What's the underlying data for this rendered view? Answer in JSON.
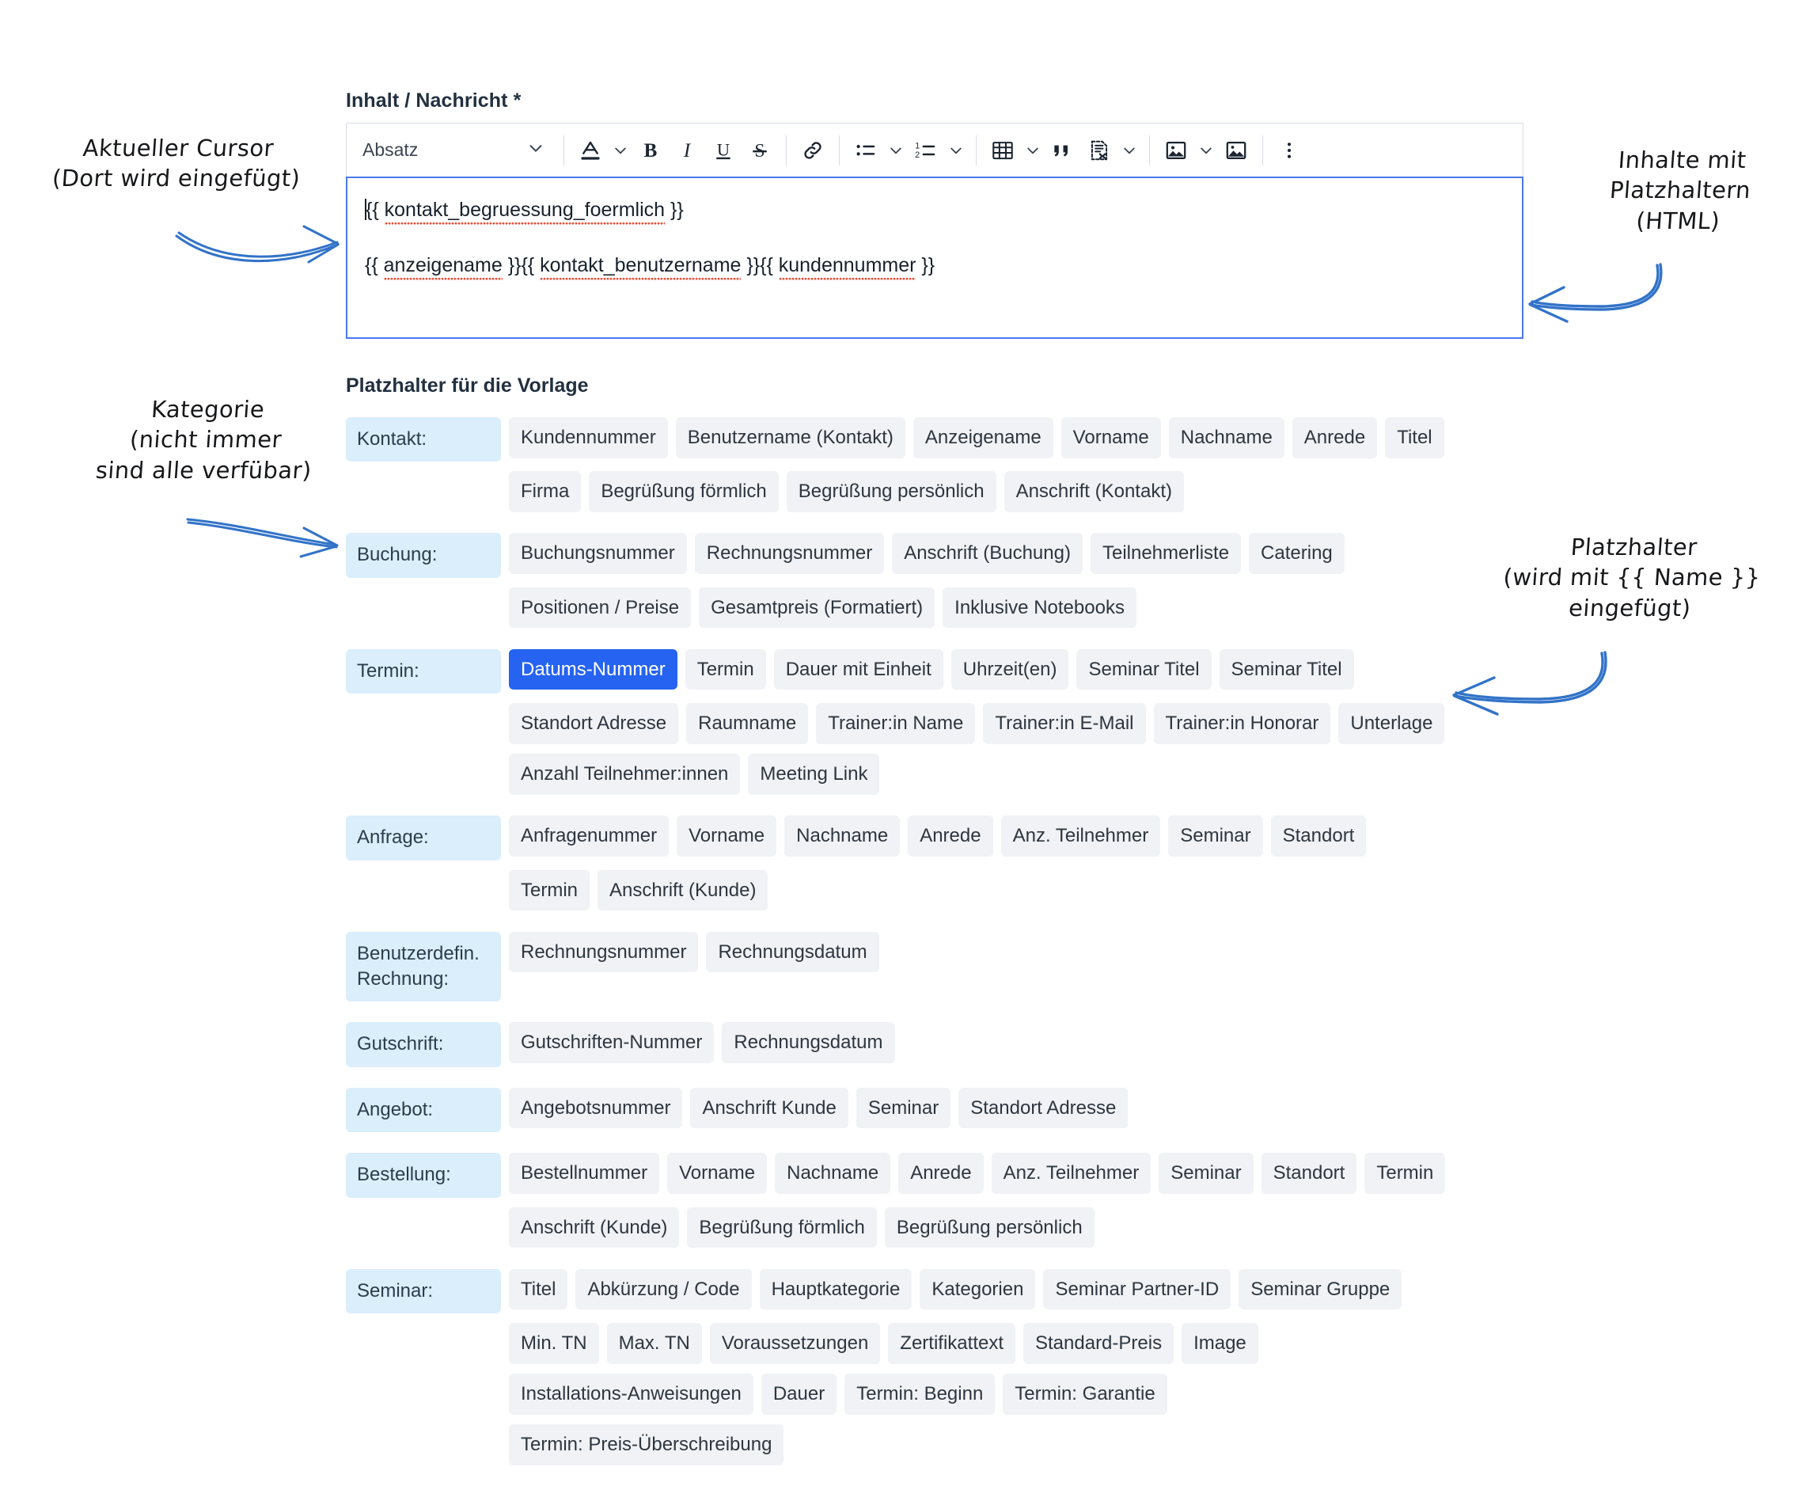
{
  "field": {
    "label": "Inhalt / Nachricht *"
  },
  "toolbar": {
    "block_style": "Absatz",
    "items": [
      {
        "name": "block-style-select",
        "label": "Absatz"
      },
      {
        "name": "text-color-button",
        "label": "A"
      },
      {
        "name": "bold-button",
        "label": "B"
      },
      {
        "name": "italic-button",
        "label": "I"
      },
      {
        "name": "underline-button",
        "label": "U"
      },
      {
        "name": "strikethrough-button",
        "label": "S"
      },
      {
        "name": "link-button",
        "label": "Link"
      },
      {
        "name": "bullet-list-button",
        "label": "Aufzählungsliste"
      },
      {
        "name": "numbered-list-button",
        "label": "Nummerierte Liste"
      },
      {
        "name": "table-button",
        "label": "Tabelle"
      },
      {
        "name": "blockquote-button",
        "label": "Zitat"
      },
      {
        "name": "code-block-button",
        "label": "Code-Block"
      },
      {
        "name": "image-button",
        "label": "Bild"
      },
      {
        "name": "media-button",
        "label": "Medien"
      },
      {
        "name": "more-options-button",
        "label": "Mehr"
      }
    ]
  },
  "editor": {
    "lines": [
      {
        "text": "{{ kontakt_begruessung_foermlich }}",
        "spellcheck_word": "kontakt_begruessung_foermlich",
        "has_caret": true
      },
      {
        "text": "{{ anzeigename }}{{ kontakt_benutzername }}{{ kundennummer }}",
        "has_caret": false
      }
    ],
    "line1_prefix": "{{ ",
    "line1_word": "kontakt_begruessung_foermlich",
    "line1_suffix": " }}",
    "line2_parts": [
      {
        "pre": "{{ ",
        "word": "anzeigename",
        "post": " }}"
      },
      {
        "pre": "{{ ",
        "word": "kontakt_benutzername",
        "post": " }}"
      },
      {
        "pre": "{{ ",
        "word": "kundennummer",
        "post": " }}"
      }
    ]
  },
  "placeholders": {
    "title": "Platzhalter für die Vorlage",
    "selected_chip": "Datums-Nummer",
    "categories": [
      {
        "label": "Kontakt:",
        "rows": [
          [
            "Kundennummer",
            "Benutzername (Kontakt)",
            "Anzeigename",
            "Vorname",
            "Nachname",
            "Anrede",
            "Titel"
          ],
          [
            "Firma",
            "Begrüßung förmlich",
            "Begrüßung persönlich",
            "Anschrift (Kontakt)"
          ]
        ]
      },
      {
        "label": "Buchung:",
        "rows": [
          [
            "Buchungsnummer",
            "Rechnungsnummer",
            "Anschrift (Buchung)",
            "Teilnehmerliste",
            "Catering"
          ],
          [
            "Positionen / Preise",
            "Gesamtpreis (Formatiert)",
            "Inklusive Notebooks"
          ]
        ]
      },
      {
        "label": "Termin:",
        "rows": [
          [
            "Datums-Nummer",
            "Termin",
            "Dauer mit Einheit",
            "Uhrzeit(en)",
            "Seminar Titel",
            "Seminar Titel"
          ],
          [
            "Standort Adresse",
            "Raumname",
            "Trainer:in Name",
            "Trainer:in E-Mail",
            "Trainer:in Honorar",
            "Unterlage"
          ],
          [
            "Anzahl Teilnehmer:innen",
            "Meeting Link"
          ]
        ]
      },
      {
        "label": "Anfrage:",
        "rows": [
          [
            "Anfragenummer",
            "Vorname",
            "Nachname",
            "Anrede",
            "Anz. Teilnehmer",
            "Seminar",
            "Standort"
          ],
          [
            "Termin",
            "Anschrift (Kunde)"
          ]
        ]
      },
      {
        "label": "Benutzerdefin. Rechnung:",
        "rows": [
          [
            "Rechnungsnummer",
            "Rechnungsdatum"
          ]
        ]
      },
      {
        "label": "Gutschrift:",
        "rows": [
          [
            "Gutschriften-Nummer",
            "Rechnungsdatum"
          ]
        ]
      },
      {
        "label": "Angebot:",
        "rows": [
          [
            "Angebotsnummer",
            "Anschrift Kunde",
            "Seminar",
            "Standort Adresse"
          ]
        ]
      },
      {
        "label": "Bestellung:",
        "rows": [
          [
            "Bestellnummer",
            "Vorname",
            "Nachname",
            "Anrede",
            "Anz. Teilnehmer",
            "Seminar",
            "Standort",
            "Termin"
          ],
          [
            "Anschrift (Kunde)",
            "Begrüßung förmlich",
            "Begrüßung persönlich"
          ]
        ]
      },
      {
        "label": "Seminar:",
        "rows": [
          [
            "Titel",
            "Abkürzung / Code",
            "Hauptkategorie",
            "Kategorien",
            "Seminar Partner-ID",
            "Seminar Gruppe"
          ],
          [
            "Min. TN",
            "Max. TN",
            "Voraussetzungen",
            "Zertifikattext",
            "Standard-Preis",
            "Image"
          ],
          [
            "Installations-Anweisungen",
            "Dauer",
            "Termin: Beginn",
            "Termin: Garantie"
          ],
          [
            "Termin: Preis-Überschreibung"
          ]
        ]
      }
    ]
  },
  "annotations": [
    {
      "name": "annotation-cursor",
      "text": "Aktueller Cursor\n(Dort wird eingefügt)"
    },
    {
      "name": "annotation-content-placeholders",
      "text": "Inhalte mit\nPlatzhaltern\n(HTML)"
    },
    {
      "name": "annotation-category",
      "text": "Kategorie\n(nicht immer\nsind alle verfübar)"
    },
    {
      "name": "annotation-placeholder",
      "text": "Platzhalter\n(wird mit {{ Name }}\neingefügt)"
    }
  ],
  "colors": {
    "annotation_ink": "#17181a",
    "arrow_blue": "#3273c8",
    "chip_bg": "#f1f2f5",
    "chip_selected_bg": "#2563f0",
    "category_bg": "#daeefb",
    "editor_focus_border": "#4a79ef",
    "spellcheck_underline": "#e8513a"
  }
}
